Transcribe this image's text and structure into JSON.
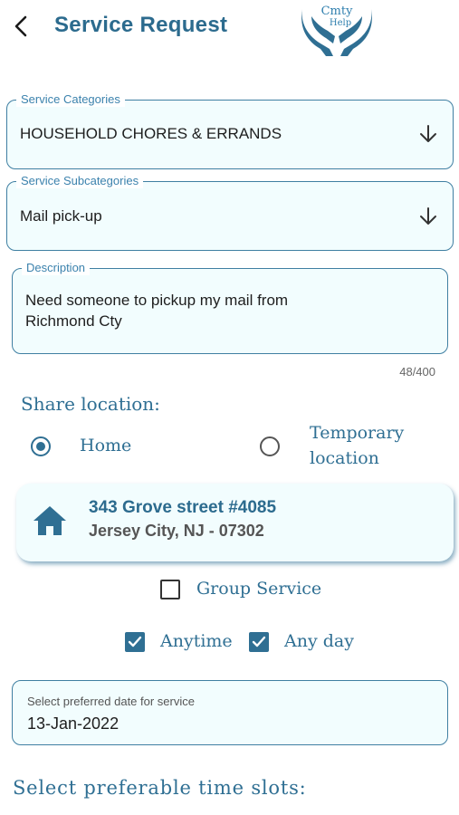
{
  "header": {
    "title": "Service Request",
    "logo_line1": "Cmty",
    "logo_line2": "Help"
  },
  "service_categories": {
    "label": "Service Categories",
    "value": "HOUSEHOLD CHORES & ERRANDS"
  },
  "service_subcategories": {
    "label": "Service Subcategories",
    "value": "Mail pick-up"
  },
  "description": {
    "label": "Description",
    "line1": "Need someone to pickup my mail from",
    "line2": "Richmond Cty",
    "counter": "48/400"
  },
  "share_location": {
    "title": "Share location:",
    "option_home": "Home",
    "option_temp_line1": "Temporary",
    "option_temp_line2": "location",
    "selected": "Home"
  },
  "address": {
    "line1": "343 Grove street #4085",
    "line2": "Jersey City, NJ - 07302"
  },
  "group_service": {
    "label": "Group Service",
    "checked": false
  },
  "anytime": {
    "label": "Anytime",
    "checked": true
  },
  "anyday": {
    "label": "Any day",
    "checked": true
  },
  "preferred_date": {
    "label": "Select preferred date for service",
    "value": "13-Jan-2022"
  },
  "time_slots": {
    "title": "Select preferable time slots:"
  },
  "colors": {
    "accent": "#2f6f93",
    "field_bg": "#f2fdfe",
    "border": "#3f7fa2"
  }
}
